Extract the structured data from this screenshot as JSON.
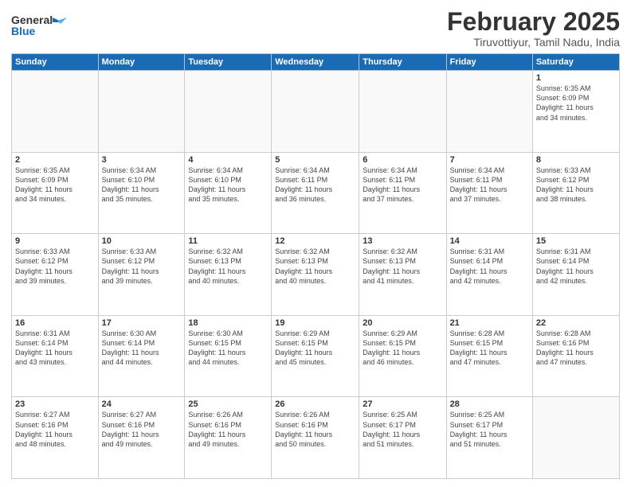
{
  "logo": {
    "general": "General",
    "blue": "Blue"
  },
  "title": "February 2025",
  "subtitle": "Tiruvottiyur, Tamil Nadu, India",
  "weekdays": [
    "Sunday",
    "Monday",
    "Tuesday",
    "Wednesday",
    "Thursday",
    "Friday",
    "Saturday"
  ],
  "weeks": [
    [
      {
        "day": "",
        "info": ""
      },
      {
        "day": "",
        "info": ""
      },
      {
        "day": "",
        "info": ""
      },
      {
        "day": "",
        "info": ""
      },
      {
        "day": "",
        "info": ""
      },
      {
        "day": "",
        "info": ""
      },
      {
        "day": "1",
        "info": "Sunrise: 6:35 AM\nSunset: 6:09 PM\nDaylight: 11 hours\nand 34 minutes."
      }
    ],
    [
      {
        "day": "2",
        "info": "Sunrise: 6:35 AM\nSunset: 6:09 PM\nDaylight: 11 hours\nand 34 minutes."
      },
      {
        "day": "3",
        "info": "Sunrise: 6:34 AM\nSunset: 6:10 PM\nDaylight: 11 hours\nand 35 minutes."
      },
      {
        "day": "4",
        "info": "Sunrise: 6:34 AM\nSunset: 6:10 PM\nDaylight: 11 hours\nand 35 minutes."
      },
      {
        "day": "5",
        "info": "Sunrise: 6:34 AM\nSunset: 6:11 PM\nDaylight: 11 hours\nand 36 minutes."
      },
      {
        "day": "6",
        "info": "Sunrise: 6:34 AM\nSunset: 6:11 PM\nDaylight: 11 hours\nand 37 minutes."
      },
      {
        "day": "7",
        "info": "Sunrise: 6:34 AM\nSunset: 6:11 PM\nDaylight: 11 hours\nand 37 minutes."
      },
      {
        "day": "8",
        "info": "Sunrise: 6:33 AM\nSunset: 6:12 PM\nDaylight: 11 hours\nand 38 minutes."
      }
    ],
    [
      {
        "day": "9",
        "info": "Sunrise: 6:33 AM\nSunset: 6:12 PM\nDaylight: 11 hours\nand 39 minutes."
      },
      {
        "day": "10",
        "info": "Sunrise: 6:33 AM\nSunset: 6:12 PM\nDaylight: 11 hours\nand 39 minutes."
      },
      {
        "day": "11",
        "info": "Sunrise: 6:32 AM\nSunset: 6:13 PM\nDaylight: 11 hours\nand 40 minutes."
      },
      {
        "day": "12",
        "info": "Sunrise: 6:32 AM\nSunset: 6:13 PM\nDaylight: 11 hours\nand 40 minutes."
      },
      {
        "day": "13",
        "info": "Sunrise: 6:32 AM\nSunset: 6:13 PM\nDaylight: 11 hours\nand 41 minutes."
      },
      {
        "day": "14",
        "info": "Sunrise: 6:31 AM\nSunset: 6:14 PM\nDaylight: 11 hours\nand 42 minutes."
      },
      {
        "day": "15",
        "info": "Sunrise: 6:31 AM\nSunset: 6:14 PM\nDaylight: 11 hours\nand 42 minutes."
      }
    ],
    [
      {
        "day": "16",
        "info": "Sunrise: 6:31 AM\nSunset: 6:14 PM\nDaylight: 11 hours\nand 43 minutes."
      },
      {
        "day": "17",
        "info": "Sunrise: 6:30 AM\nSunset: 6:14 PM\nDaylight: 11 hours\nand 44 minutes."
      },
      {
        "day": "18",
        "info": "Sunrise: 6:30 AM\nSunset: 6:15 PM\nDaylight: 11 hours\nand 44 minutes."
      },
      {
        "day": "19",
        "info": "Sunrise: 6:29 AM\nSunset: 6:15 PM\nDaylight: 11 hours\nand 45 minutes."
      },
      {
        "day": "20",
        "info": "Sunrise: 6:29 AM\nSunset: 6:15 PM\nDaylight: 11 hours\nand 46 minutes."
      },
      {
        "day": "21",
        "info": "Sunrise: 6:28 AM\nSunset: 6:15 PM\nDaylight: 11 hours\nand 47 minutes."
      },
      {
        "day": "22",
        "info": "Sunrise: 6:28 AM\nSunset: 6:16 PM\nDaylight: 11 hours\nand 47 minutes."
      }
    ],
    [
      {
        "day": "23",
        "info": "Sunrise: 6:27 AM\nSunset: 6:16 PM\nDaylight: 11 hours\nand 48 minutes."
      },
      {
        "day": "24",
        "info": "Sunrise: 6:27 AM\nSunset: 6:16 PM\nDaylight: 11 hours\nand 49 minutes."
      },
      {
        "day": "25",
        "info": "Sunrise: 6:26 AM\nSunset: 6:16 PM\nDaylight: 11 hours\nand 49 minutes."
      },
      {
        "day": "26",
        "info": "Sunrise: 6:26 AM\nSunset: 6:16 PM\nDaylight: 11 hours\nand 50 minutes."
      },
      {
        "day": "27",
        "info": "Sunrise: 6:25 AM\nSunset: 6:17 PM\nDaylight: 11 hours\nand 51 minutes."
      },
      {
        "day": "28",
        "info": "Sunrise: 6:25 AM\nSunset: 6:17 PM\nDaylight: 11 hours\nand 51 minutes."
      },
      {
        "day": "",
        "info": ""
      }
    ]
  ]
}
